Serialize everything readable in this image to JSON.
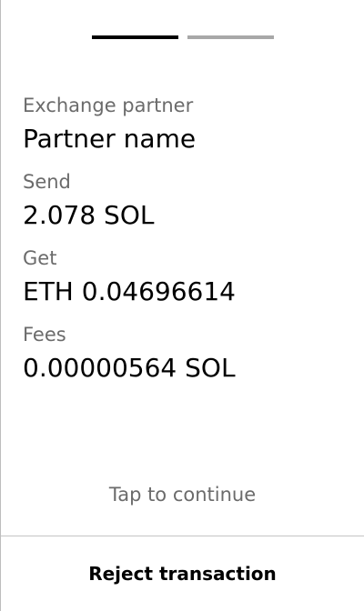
{
  "progress": {
    "current_step": 1,
    "total_steps": 2
  },
  "details": [
    {
      "label": "Exchange partner",
      "value": "Partner name"
    },
    {
      "label": "Send",
      "value": "2.078 SOL"
    },
    {
      "label": "Get",
      "value": "ETH 0.04696614"
    },
    {
      "label": "Fees",
      "value": "0.00000564 SOL"
    }
  ],
  "footer": {
    "tap_hint": "Tap to continue",
    "reject_label": "Reject transaction"
  },
  "colors": {
    "active_step": "#000000",
    "inactive_step": "#a8a8a8",
    "label_text": "#6b6b6b",
    "divider": "#c4c4c4"
  }
}
